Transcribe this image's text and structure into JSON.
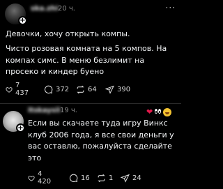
{
  "posts": [
    {
      "username": "ska.zhi",
      "time": "20 ч.",
      "text_paragraphs": [
        "Девочки, хочу открыть компы.",
        "Чисто розовая комната на 5 компов. На компах симс. В меню безлимит на просеко и киндер буено"
      ],
      "likes": "7 437",
      "comments": "372",
      "reposts": "64",
      "shares": "390"
    },
    {
      "username": "itskaysii",
      "time": "19 ч.",
      "text_paragraphs": [
        "Если вы скачаете туда игру Винкс клуб 2006 года, я все свои деньги у вас оставлю, пожалуйста сделайте это"
      ],
      "likes": "4 420",
      "comments": "16",
      "reposts": "1",
      "shares": "24"
    }
  ],
  "icons": {
    "like": "heart-icon",
    "comment": "comment-icon",
    "repost": "repost-icon",
    "share": "share-icon",
    "more": "more-icon",
    "follow": "plus-icon"
  },
  "colors": {
    "background": "#000000",
    "text": "#f3f5f7",
    "muted": "#8a8a8a",
    "divider": "#2a2a2a"
  }
}
